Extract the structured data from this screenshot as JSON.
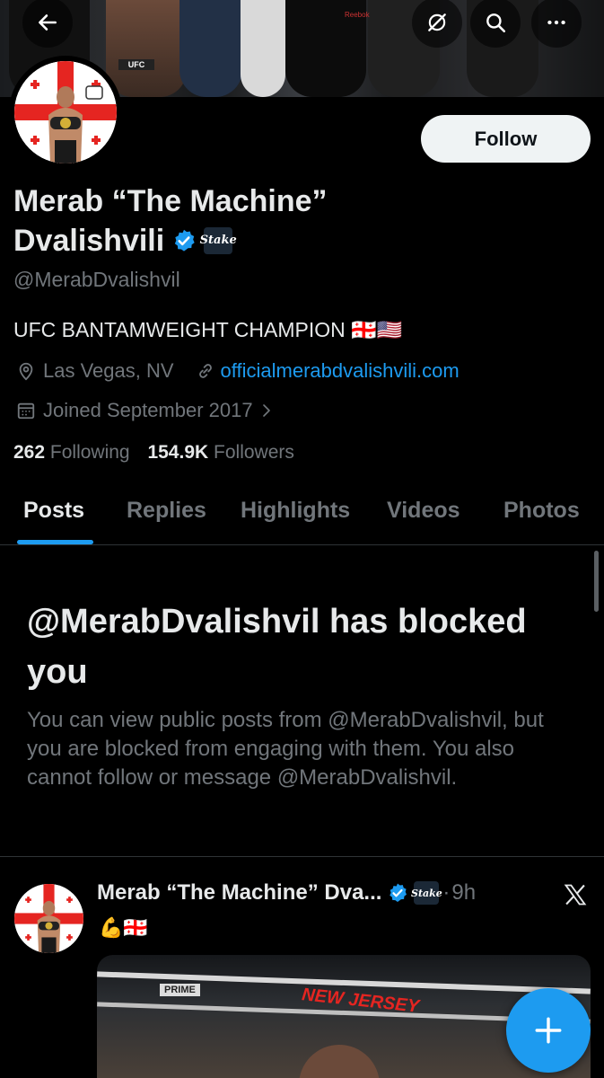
{
  "profile": {
    "name_line1": "Merab “The Machine”",
    "name_line2": "Dvalishvili",
    "stake_badge": "Stake",
    "handle": "@MerabDvalishvil",
    "bio": "UFC BANTAMWEIGHT CHAMPION 🇬🇪🇺🇸",
    "location": "Las Vegas, NV",
    "website": "officialmerabdvalishvili.com",
    "joined": "Joined September 2017",
    "following_count": "262",
    "following_label": "Following",
    "followers_count": "154.9K",
    "followers_label": "Followers"
  },
  "header": {
    "follow_label": "Follow",
    "banner_text_ufc": "UFC",
    "banner_text_reebok": "Reebok"
  },
  "tabs": [
    {
      "label": "Posts",
      "active": true
    },
    {
      "label": "Replies",
      "active": false
    },
    {
      "label": "Highlights",
      "active": false
    },
    {
      "label": "Videos",
      "active": false
    },
    {
      "label": "Photos",
      "active": false
    }
  ],
  "blocked": {
    "title": "@MerabDvalishvil has blocked you",
    "description": "You can view public posts from @MerabDvalishvil, but you are blocked from engaging with them. You also cannot follow or message @MerabDvalishvil."
  },
  "post": {
    "author": "Merab “The Machine” Dva...",
    "stake_badge": "Stake",
    "separator": "·",
    "time": "9h",
    "text": "💪🇬🇪",
    "media_text_prime": "PRIME",
    "media_text_banner": "NEW JERSEY"
  },
  "icons": {
    "back": "arrow-left-icon",
    "grok": "grok-icon",
    "search": "search-icon",
    "more": "more-horizontal-icon",
    "location": "location-pin-icon",
    "link": "link-icon",
    "calendar": "calendar-icon",
    "verified": "verified-badge-icon",
    "x_logo": "x-logo-icon",
    "compose": "plus-icon"
  },
  "colors": {
    "accent": "#1d9bf0",
    "background": "#000000",
    "text_primary": "#e7e9ea",
    "text_secondary": "#71767b"
  }
}
